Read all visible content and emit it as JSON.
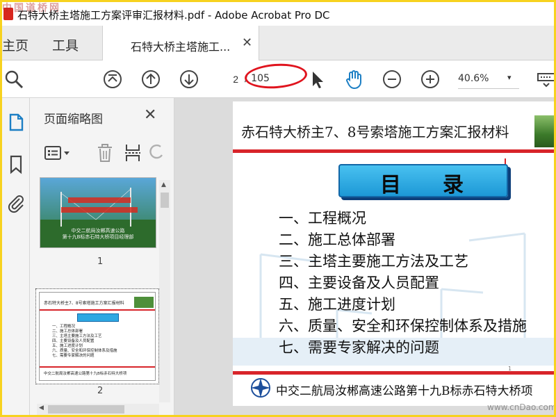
{
  "window": {
    "title": "石特大桥主塔施工方案评审汇报材料.pdf - Adobe Acrobat Pro DC",
    "watermark": "中国道桥网"
  },
  "tabs": {
    "home": "主页",
    "tools": "工具",
    "document": "石特大桥主塔施工...",
    "close_symbol": "✕"
  },
  "toolbar": {
    "current_page": "2",
    "page_total": "/ 105",
    "zoom": "40.6%",
    "zoom_caret": "▾"
  },
  "sidebar": {
    "panel_title": "页面缩略图",
    "close_symbol": "✕",
    "thumb1_label": "1",
    "thumb2_label": "2",
    "thumb1_company": "中交二航局汝郴高速公路",
    "thumb1_section": "第十九B标赤石特大桥项目经理部"
  },
  "document": {
    "header": "赤石特大桥主7、8号索塔施工方案汇报材料",
    "contents_title": "目录",
    "toc": [
      "一、工程概况",
      "二、施工总体部署",
      "三、主塔主要施工方法及工艺",
      "四、主要设备及人员配置",
      "五、施工进度计划",
      "六、质量、安全和环保控制体系及措施",
      "七、需要专家解决的问题"
    ],
    "footer": "中交二航局汝郴高速公路第十九B标赤石特大桥项",
    "page_marker": "1"
  },
  "watermark_br": "www.cnDao.com",
  "colors": {
    "frame_border": "#f7d21f",
    "acrobat_red": "#d8261e",
    "accent_blue": "#1d98d6",
    "annotation_red": "#e0141e",
    "rule_red": "#d8242a"
  },
  "icons": [
    "search-icon",
    "page-up-icon",
    "prev-page-icon",
    "next-page-icon",
    "select-cursor-icon",
    "hand-tool-icon",
    "zoom-out-icon",
    "zoom-in-icon",
    "keyboard-icon",
    "thumbnail-icon",
    "bookmark-icon",
    "attachment-icon",
    "options-icon",
    "delete-icon",
    "insert-page-icon",
    "undo-icon"
  ]
}
